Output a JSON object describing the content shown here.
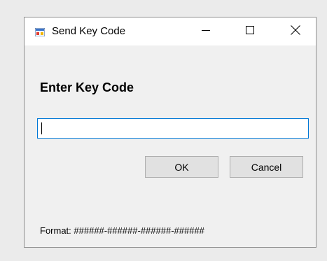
{
  "window": {
    "title": "Send Key Code",
    "icon": "app-window-icon",
    "controls": {
      "minimize": "minimize-icon",
      "maximize": "maximize-icon",
      "close": "close-icon"
    }
  },
  "dialog": {
    "heading": "Enter Key Code",
    "key_input": {
      "value": "",
      "placeholder": ""
    },
    "ok_label": "OK",
    "cancel_label": "Cancel",
    "format_hint": "Format: ######-######-######-######"
  },
  "colors": {
    "focus_border": "#0078d7",
    "button_face": "#e1e1e1",
    "window_background": "#f0f0f0"
  }
}
